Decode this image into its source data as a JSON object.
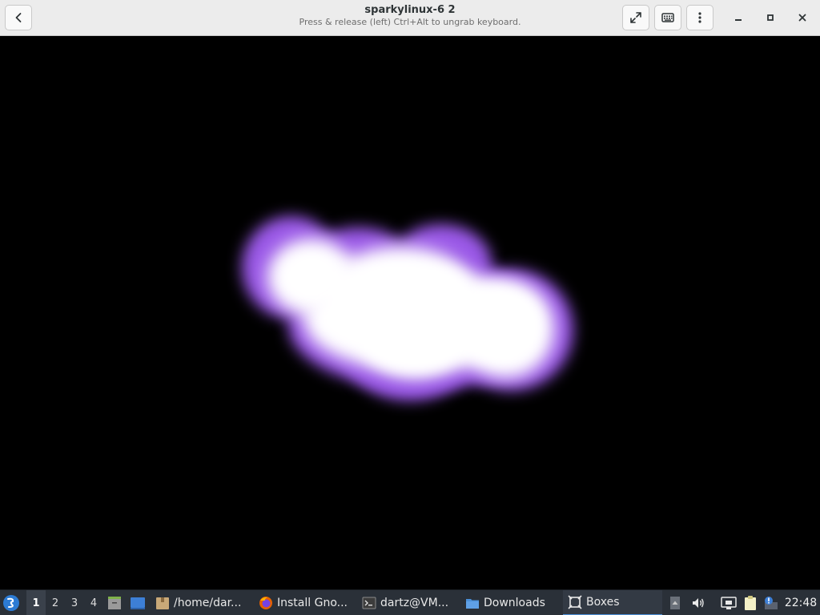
{
  "window": {
    "title": "sparkylinux-6 2",
    "subtitle": "Press & release (left) Ctrl+Alt to ungrab keyboard."
  },
  "icons": {
    "back": "back-arrow-icon",
    "fullscreen": "fullscreen-icon",
    "keyboard": "keyboard-icon",
    "menu": "kebab-menu-icon",
    "minimize": "minimize-icon",
    "maximize": "maximize-icon",
    "close": "close-icon"
  },
  "colors": {
    "headerbar_bg": "#ececec",
    "vm_bg": "#000000",
    "glow_purple": "#9b59e8",
    "glow_white": "#ffffff",
    "taskbar_bg": "#2a3038",
    "task_active_underline": "#4a8fd8"
  },
  "taskbar": {
    "workspaces": [
      "1",
      "2",
      "3",
      "4"
    ],
    "active_workspace": "1",
    "tasks": [
      {
        "label": "/home/dar...",
        "icon": "archive-folder-icon"
      },
      {
        "label": "Install Gno...",
        "icon": "firefox-icon"
      },
      {
        "label": "dartz@VM...",
        "icon": "terminal-icon"
      },
      {
        "label": "Downloads",
        "icon": "folder-icon"
      },
      {
        "label": "Boxes",
        "icon": "boxes-icon"
      }
    ],
    "clock": "22:48"
  }
}
